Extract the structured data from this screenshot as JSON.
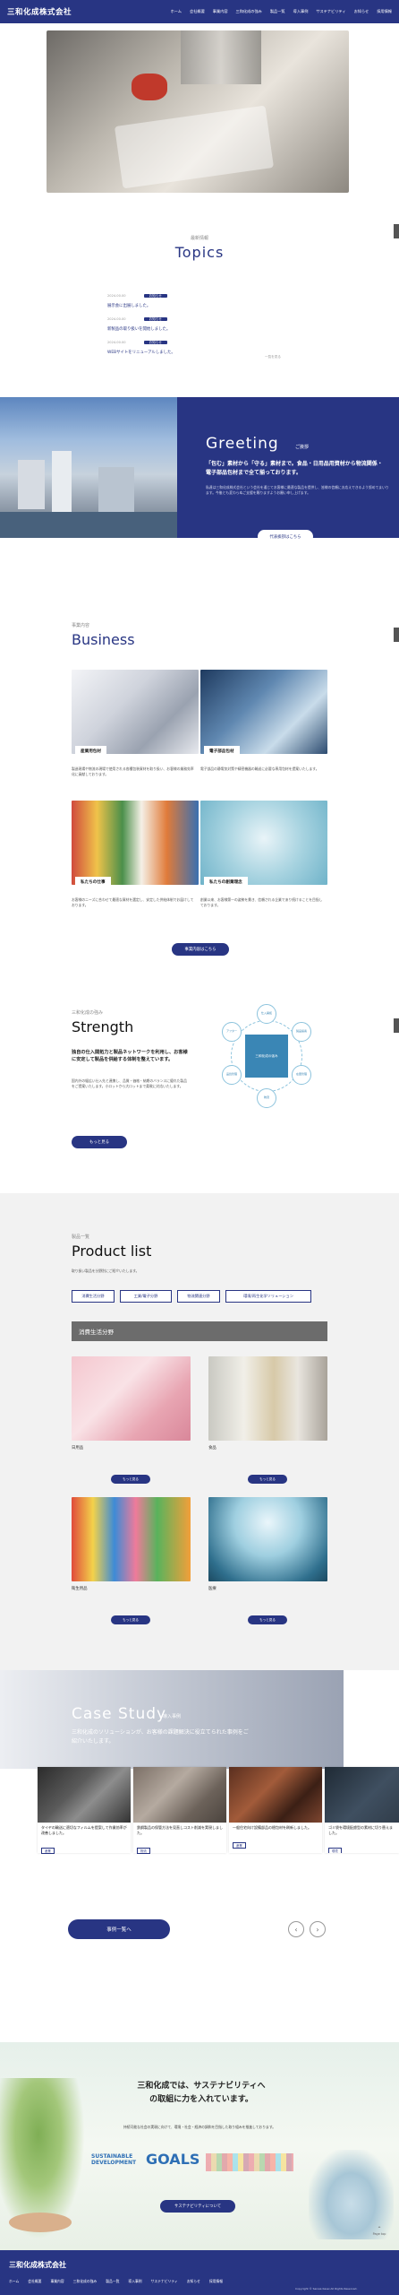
{
  "header": {
    "logo": "三和化成株式会社",
    "nav": [
      "ホーム",
      "会社概要",
      "事業内容",
      "三和化成の強み",
      "製品一覧",
      "導入事例",
      "サステナビリティ",
      "お知らせ",
      "採用情報"
    ]
  },
  "topics": {
    "sub": "最新情報",
    "title": "Topics",
    "items": [
      {
        "date": "2024.00.00",
        "tag": "お知らせ",
        "text": "展示会に出展しました。"
      },
      {
        "date": "2024.00.00",
        "tag": "お知らせ",
        "text": "新製品の取り扱いを開始しました。"
      },
      {
        "date": "2024.00.00",
        "tag": "お知らせ",
        "text": "WEBサイトをリニューアルしました。"
      }
    ],
    "more": "一覧を見る"
  },
  "greeting": {
    "title": "Greeting",
    "title_sub": "ご挨拶",
    "lead": "「包む」素材から「守る」素材まで。食品・日用品用資材から物流関係・電子部品包材まで全て揃っております。",
    "body": "私達は三和化成株式会社という会社を通じてお客様に最適な製品を提供し、皆様の信頼にお応えできるよう努めてまいります。今後とも変わらぬご支援を賜りますようお願い申し上げます。",
    "btn": "代表挨拶はこちら"
  },
  "business": {
    "sub": "事業内容",
    "title": "Business",
    "cards": [
      {
        "label": "産業用包材",
        "desc": "製造現場や物流の現場で使用される各種包装資材を取り扱い、お客様の業務効率化に貢献しております。"
      },
      {
        "label": "電子部品包材",
        "desc": "電子部品の静電気対策や精密機器の輸送に必要な専用包材を提案いたします。"
      },
      {
        "label": "私たちの仕事",
        "desc": "お客様のニーズに合わせて最適な資材を選定し、安定した供給体制でお届けしております。"
      },
      {
        "label": "私たちの創業理念",
        "desc": "創業以来、お客様第一の姿勢を貫き、信頼される企業であり続けることを目指しております。"
      }
    ],
    "btn": "事業内容はこちら"
  },
  "strength": {
    "sub": "三和化成の強み",
    "title": "Strength",
    "lead": "独自の仕入開拓力と製品ネットワークを利用し、お客様に安定して製品を供給する体制を整えています。",
    "body": "国内外の幅広い仕入先と連携し、品質・価格・納期のバランスに優れた製品をご提案いたします。小ロットから大ロットまで柔軟に対応いたします。",
    "btn": "もっと見る",
    "center": "三和化成の強み",
    "nodes": [
      "仕入開拓",
      "製品提案",
      "在庫管理",
      "物流",
      "品質管理",
      "アフター"
    ]
  },
  "products": {
    "sub": "製品一覧",
    "title": "Product list",
    "desc": "取り扱い製品を分野別にご紹介いたします。",
    "tabs": [
      "消費生活分野",
      "工業/電子分野",
      "物流関連分野",
      "環境/再生化学ソリューション"
    ],
    "band": "消費生活分野",
    "items": [
      {
        "caption": "日用品"
      },
      {
        "caption": "食品"
      },
      {
        "caption": "衛生用品"
      },
      {
        "caption": "医療"
      }
    ],
    "more": "もっと見る"
  },
  "case": {
    "title": "Case Study",
    "title_sub": "導入事例",
    "lead": "三和化成のソリューションが、お客様の課題解決に役立てられた事例をご紹介いたします。",
    "cards": [
      {
        "text": "タイヤの輸送に適切なフィルムを提案して作業効率が改善しました。",
        "tag": "産業"
      },
      {
        "text": "鉄鋼製品の保管方法を見直しコスト削減を実現しました。",
        "tag": "物流"
      },
      {
        "text": "一般住宅向け設備部品の梱包材を刷新しました。",
        "tag": "産業"
      },
      {
        "text": "ゴミ袋を環境配慮型の素材に切り替えました。",
        "tag": "環境"
      }
    ],
    "btn": "事例一覧へ"
  },
  "sustain": {
    "title": "三和化成では、サステナビリティへの取組に力を入れています。",
    "body": "持続可能な社会の実現に向けて、環境・社会・経済の調和を目指した取り組みを推進しております。",
    "sdg_top": "SUSTAINABLE",
    "sdg_bottom": "DEVELOPMENT",
    "goals": "GOALS",
    "btn": "サステナビリティについて",
    "pagetop": "Page top"
  },
  "footer": {
    "logo": "三和化成株式会社",
    "nav": [
      "ホーム",
      "会社概要",
      "事業内容",
      "三和化成の強み",
      "製品一覧",
      "導入事例",
      "サステナビリティ",
      "お知らせ",
      "採用情報"
    ],
    "copy": "Copyright © Sanwa Kasei All Rights Reserved."
  }
}
